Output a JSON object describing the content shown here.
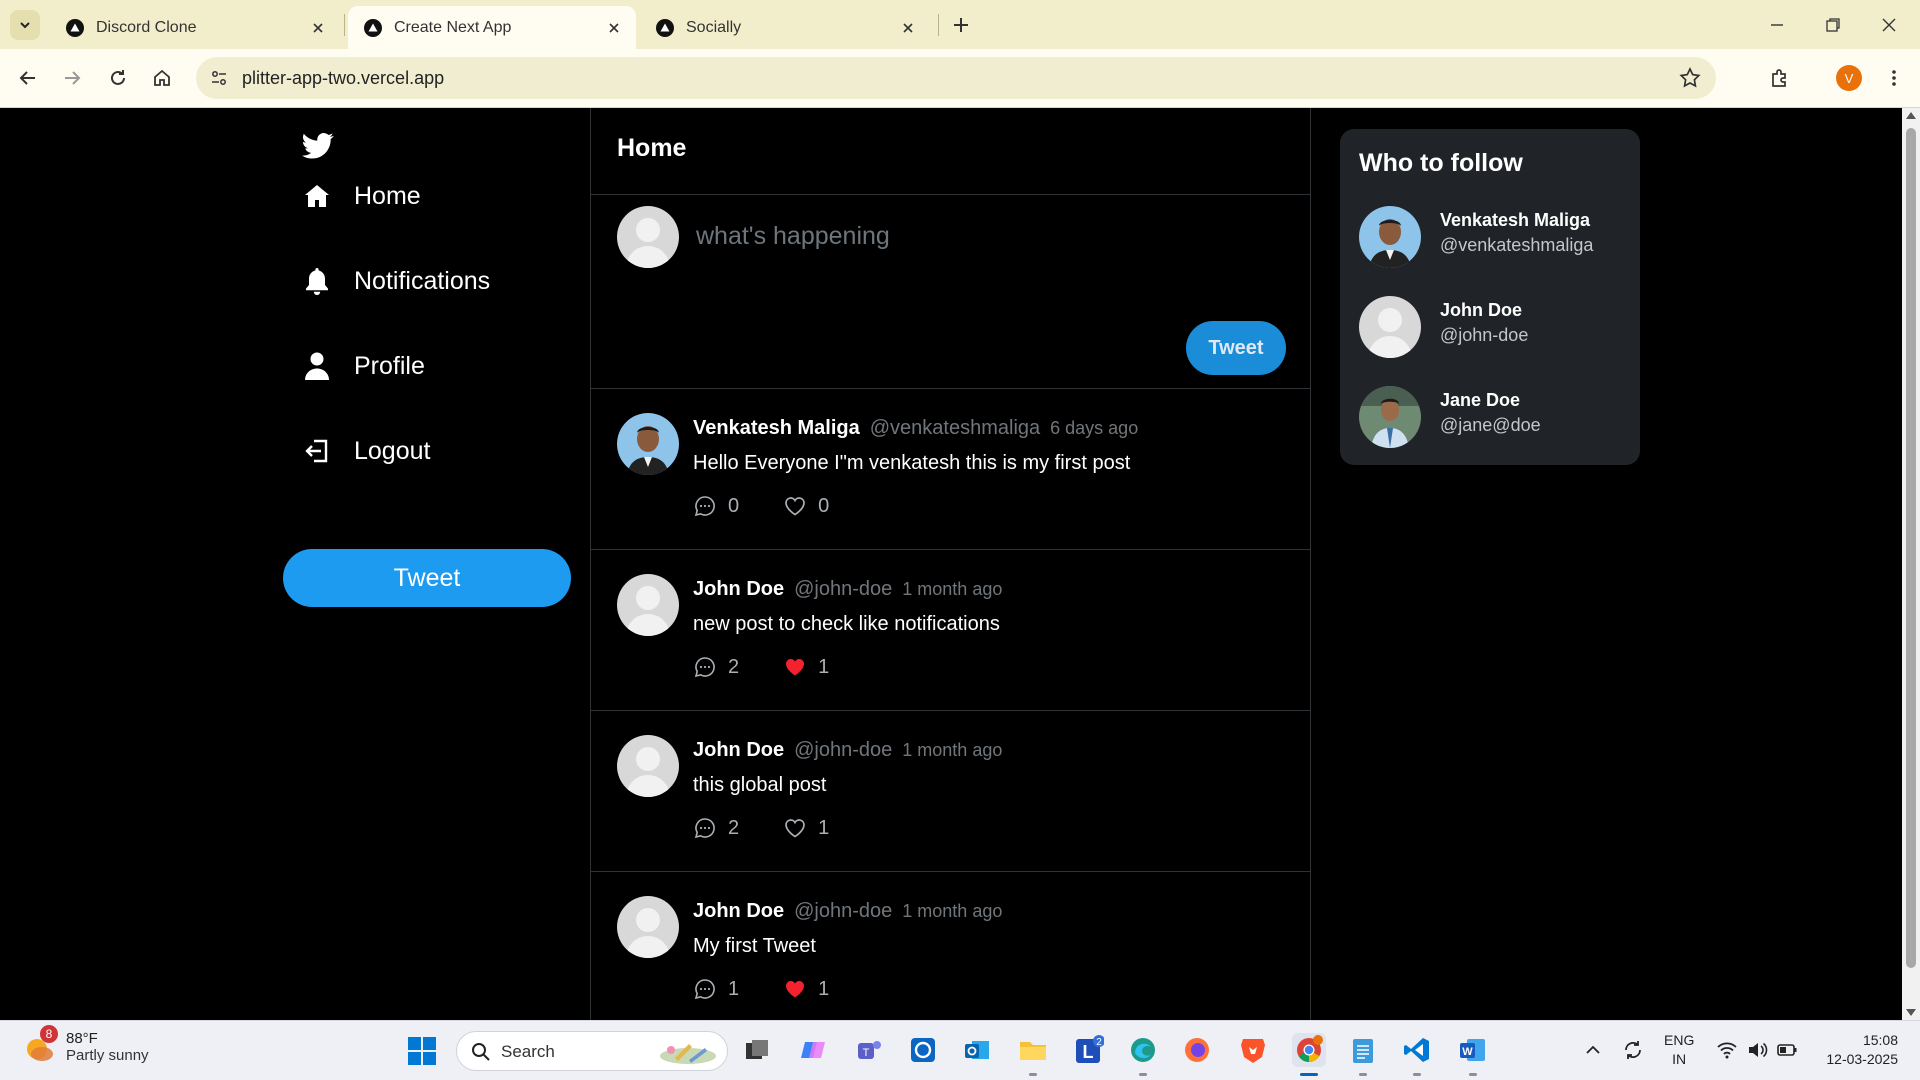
{
  "browser": {
    "tabs": [
      {
        "title": "Discord Clone",
        "active": false
      },
      {
        "title": "Create Next App",
        "active": true
      },
      {
        "title": "Socially",
        "active": false
      }
    ],
    "url": "plitter-app-two.vercel.app",
    "profile_initial": "V"
  },
  "app": {
    "sidebar": {
      "items": [
        {
          "label": "Home",
          "icon": "home-icon"
        },
        {
          "label": "Notifications",
          "icon": "bell-icon"
        },
        {
          "label": "Profile",
          "icon": "user-icon"
        },
        {
          "label": "Logout",
          "icon": "logout-icon"
        }
      ],
      "tweet_button": "Tweet"
    },
    "feed": {
      "title": "Home",
      "composer_placeholder": "what's happening",
      "tweet_button": "Tweet",
      "posts": [
        {
          "name": "Venkatesh Maliga",
          "handle": "@venkateshmaliga",
          "time": "6 days ago",
          "text": "Hello Everyone I\"m venkatesh this is my first post",
          "comments": "0",
          "likes": "0",
          "liked": false,
          "avatar": "photo"
        },
        {
          "name": "John Doe",
          "handle": "@john-doe",
          "time": "1 month ago",
          "text": "new post to check like notifications",
          "comments": "2",
          "likes": "1",
          "liked": true,
          "avatar": "placeholder"
        },
        {
          "name": "John Doe",
          "handle": "@john-doe",
          "time": "1 month ago",
          "text": "this global post",
          "comments": "2",
          "likes": "1",
          "liked": false,
          "avatar": "placeholder"
        },
        {
          "name": "John Doe",
          "handle": "@john-doe",
          "time": "1 month ago",
          "text": "My first Tweet",
          "comments": "1",
          "likes": "1",
          "liked": true,
          "avatar": "placeholder"
        }
      ]
    },
    "who_to_follow": {
      "title": "Who to follow",
      "users": [
        {
          "name": "Venkatesh Maliga",
          "handle": "@venkateshmaliga",
          "avatar": "photo"
        },
        {
          "name": "John Doe",
          "handle": "@john-doe",
          "avatar": "placeholder"
        },
        {
          "name": "Jane Doe",
          "handle": "@jane@doe",
          "avatar": "photo"
        }
      ]
    }
  },
  "taskbar": {
    "weather_temp": "88°F",
    "weather_desc": "Partly sunny",
    "weather_badge": "8",
    "search_placeholder": "Search",
    "lang_line1": "ENG",
    "lang_line2": "IN",
    "time": "15:08",
    "date": "12-03-2025",
    "teams_badge": "2"
  },
  "colors": {
    "accent": "#1d9bf0",
    "like_red": "#f91880",
    "background": "#000000"
  }
}
